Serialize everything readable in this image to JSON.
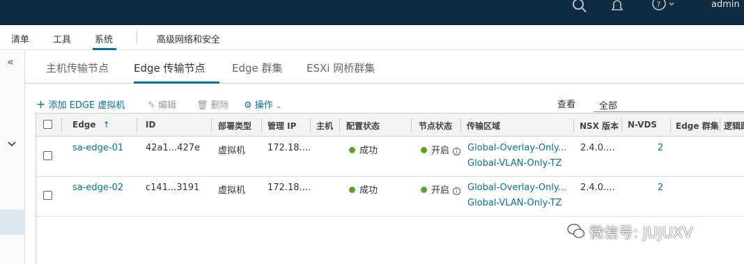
{
  "header": {
    "user": "admin",
    "icons": [
      "search-icon",
      "bell-icon",
      "help-icon"
    ]
  },
  "mainnav": {
    "items": [
      "清单",
      "工具",
      "系统",
      "高级网络和安全"
    ],
    "active": "系统"
  },
  "tabs": {
    "items": [
      "主机传输节点",
      "Edge 传输节点",
      "Edge 群集",
      "ESXi 网桥群集"
    ],
    "active": "Edge 传输节点"
  },
  "toolbar": {
    "add": "添加 EDGE 虚拟机",
    "edit": "编辑",
    "delete": "删除",
    "actions": "操作"
  },
  "filter": {
    "label": "查看",
    "value": "全部"
  },
  "table": {
    "columns": [
      "Edge",
      "ID",
      "部署类型",
      "管理 IP",
      "主机",
      "配置状态",
      "节点状态",
      "传输区域",
      "NSX 版本",
      "N-VDS",
      "Edge 群集",
      "逻辑路"
    ],
    "sort_indicator": "↑",
    "rows": [
      {
        "edge": "sa-edge-01",
        "id": "42a1...427e",
        "deploy": "虚拟机",
        "ip": "172.18....",
        "host": "",
        "config": "成功",
        "node": "开启",
        "tz1": "Global-Overlay-Only...",
        "tz2": "Global-VLAN-Only-TZ",
        "nsx": "2.4.0....",
        "nvds": "2",
        "cluster": ""
      },
      {
        "edge": "sa-edge-02",
        "id": "c141...3191",
        "deploy": "虚拟机",
        "ip": "172.18....",
        "host": "",
        "config": "成功",
        "node": "开启",
        "tz1": "Global-Overlay-Only...",
        "tz2": "Global-VLAN-Only-TZ",
        "nsx": "2.4.0....",
        "nvds": "2",
        "cluster": ""
      }
    ]
  },
  "watermark": {
    "text": "微信号: JUJUXV"
  },
  "colors": {
    "topbar": "#0f2b3f",
    "accent": "#0072a3",
    "success": "#5aa220"
  }
}
